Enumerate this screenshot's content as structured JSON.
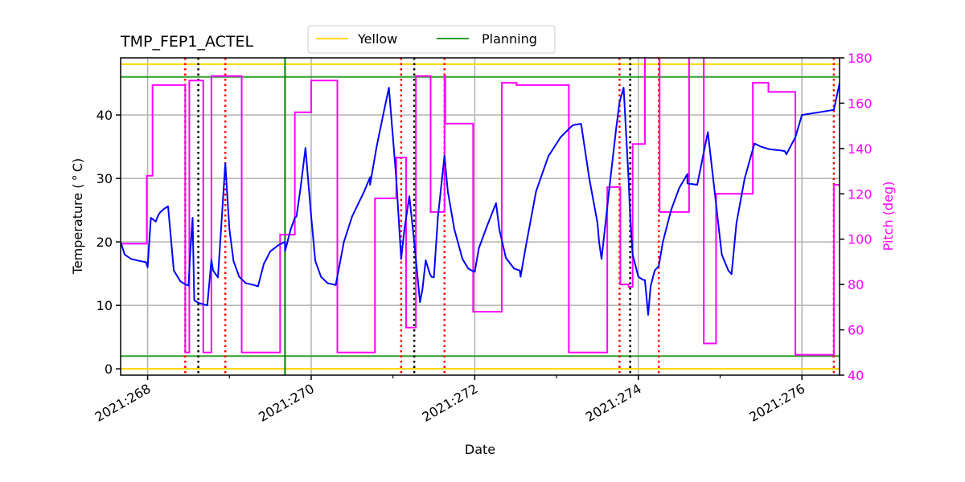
{
  "chart_data": {
    "type": "line",
    "title": "TMP_FEP1_ACTEL",
    "xlabel": "Date",
    "ylabel": "Temperature ($^\\circ$C)",
    "ylabel_display": "Temperature ( ° C)",
    "y2label": "Pitch (deg)",
    "xlim": [
      267.67,
      276.46
    ],
    "ylim": [
      -1,
      49
    ],
    "y2lim": [
      40,
      180
    ],
    "x_ticks": [
      268,
      270,
      272,
      274,
      276
    ],
    "x_tick_labels": [
      "2021:268",
      "2021:270",
      "2021:272",
      "2021:274",
      "2021:276"
    ],
    "x_minor_ticks": [
      269,
      271,
      273,
      275
    ],
    "y_ticks": [
      0,
      10,
      20,
      30,
      40
    ],
    "y2_ticks": [
      40,
      60,
      80,
      100,
      120,
      140,
      160,
      180
    ],
    "grid": true,
    "legend": {
      "placement": "top-center",
      "entries": [
        {
          "label": "Yellow",
          "color": "#ffd700"
        },
        {
          "label": "Planning",
          "color": "#2ca02c"
        }
      ]
    },
    "colors": {
      "temperature": "#0000ff",
      "pitch": "#ff00ff",
      "yellow": "#ffd700",
      "planning": "#2ca02c",
      "now_line": "#008000",
      "red_markers": "#ff0000",
      "black_markers": "#000000",
      "grid": "#b0b0b0",
      "y2_axis": "#ff00ff"
    },
    "limits": {
      "yellow_hi": 48,
      "yellow_lo": 0,
      "planning_hi": 46,
      "planning_lo": 2
    },
    "now_line_x": 269.68,
    "red_dotted_x": [
      268.46,
      268.95,
      271.1,
      271.63,
      273.77,
      274.25,
      276.39
    ],
    "black_dotted_x": [
      268.62,
      271.26,
      273.9
    ],
    "series": [
      {
        "name": "TMP_FEP1_ACTEL",
        "axis": "left",
        "x": [
          267.67,
          267.72,
          267.8,
          267.9,
          267.98,
          268.0,
          268.0,
          268.04,
          268.1,
          268.13,
          268.15,
          268.2,
          268.25,
          268.32,
          268.4,
          268.46,
          268.5,
          268.52,
          268.55,
          268.57,
          268.62,
          268.7,
          268.73,
          268.78,
          268.8,
          268.86,
          268.95,
          269.0,
          269.05,
          269.12,
          269.2,
          269.3,
          269.35,
          269.42,
          269.5,
          269.6,
          269.68,
          269.68,
          269.75,
          269.8,
          269.82,
          269.87,
          269.93,
          270.0,
          270.05,
          270.12,
          270.2,
          270.3,
          270.4,
          270.5,
          270.65,
          270.72,
          270.72,
          270.8,
          270.88,
          270.95,
          271.04,
          271.1,
          271.14,
          271.2,
          271.26,
          271.33,
          271.36,
          271.4,
          271.45,
          271.47,
          271.5,
          271.55,
          271.63,
          271.67,
          271.75,
          271.85,
          271.92,
          271.96,
          272.0,
          272.05,
          272.15,
          272.26,
          272.3,
          272.38,
          272.48,
          272.55,
          272.56,
          272.62,
          272.75,
          272.9,
          273.05,
          273.15,
          273.2,
          273.3,
          273.4,
          273.5,
          273.52,
          273.55,
          273.65,
          273.73,
          273.77,
          273.82,
          273.88,
          273.9,
          273.93,
          274.0,
          274.06,
          274.08,
          274.12,
          274.15,
          274.2,
          274.25,
          274.3,
          274.4,
          274.5,
          274.6,
          274.6,
          274.72,
          274.72,
          274.85,
          274.95,
          275.02,
          275.1,
          275.14,
          275.14,
          275.2,
          275.3,
          275.42,
          275.5,
          275.6,
          275.75,
          275.79,
          275.81,
          275.92,
          276.0,
          276.2,
          276.39,
          276.46
        ],
        "y": [
          20.0,
          18.0,
          17.3,
          17.0,
          16.8,
          16.0,
          16.0,
          23.8,
          23.2,
          24.2,
          24.6,
          25.2,
          25.6,
          15.5,
          13.8,
          13.3,
          13.1,
          18.0,
          23.8,
          10.8,
          10.4,
          10.1,
          10.0,
          17.2,
          15.5,
          14.4,
          32.4,
          22.0,
          17.0,
          14.5,
          13.5,
          13.2,
          13.0,
          16.5,
          18.5,
          19.5,
          20.0,
          18.5,
          22.0,
          23.8,
          24.0,
          28.5,
          34.8,
          24.0,
          17.0,
          14.5,
          13.5,
          13.2,
          20.0,
          24.0,
          28.0,
          30.2,
          29.0,
          35.0,
          40.0,
          44.3,
          30.0,
          17.3,
          22.0,
          27.2,
          20.0,
          10.5,
          12.5,
          17.1,
          15.0,
          14.5,
          14.4,
          24.0,
          33.6,
          28.0,
          22.0,
          17.3,
          15.8,
          15.5,
          15.3,
          19.0,
          22.5,
          26.1,
          22.0,
          17.5,
          15.8,
          15.5,
          14.5,
          19.0,
          28.0,
          33.5,
          36.5,
          37.8,
          38.4,
          38.6,
          30.0,
          23.0,
          20.0,
          17.3,
          29.0,
          38.0,
          42.0,
          44.3,
          30.0,
          24.0,
          18.0,
          14.5,
          14.0,
          14.0,
          8.5,
          13.0,
          15.5,
          16.2,
          20.0,
          25.0,
          28.5,
          30.7,
          29.2,
          29.0,
          29.0,
          37.3,
          26.0,
          18.0,
          15.5,
          14.9,
          15.0,
          23.0,
          30.0,
          35.5,
          35.0,
          34.6,
          34.4,
          34.3,
          33.8,
          36.5,
          40.0,
          40.4,
          40.8,
          45.0
        ]
      },
      {
        "name": "Pitch",
        "axis": "right",
        "step": true,
        "x": [
          267.67,
          267.96,
          267.99,
          268.02,
          268.06,
          268.13,
          268.23,
          268.46,
          268.47,
          268.51,
          268.56,
          268.68,
          268.7,
          268.78,
          268.91,
          269.15,
          269.17,
          269.2,
          269.62,
          269.68,
          269.8,
          269.97,
          270.0,
          270.01,
          270.32,
          270.66,
          270.67,
          270.78,
          270.93,
          271.04,
          271.11,
          271.16,
          271.21,
          271.28,
          271.36,
          271.46,
          271.63,
          271.64,
          271.81,
          271.98,
          272.0,
          272.11,
          272.26,
          272.33,
          272.51,
          272.58,
          273.15,
          273.46,
          273.48,
          273.62,
          273.74,
          273.78,
          273.82,
          273.88,
          273.93,
          274.05,
          274.08,
          274.16,
          274.25,
          274.26,
          274.6,
          274.62,
          274.76,
          274.8,
          274.93,
          274.95,
          275.14,
          275.4,
          275.59,
          275.77,
          275.92,
          276.03,
          276.39,
          276.42
        ],
        "y": [
          98,
          98,
          128,
          128,
          168,
          168,
          168,
          50,
          50,
          170,
          170,
          50,
          50,
          172,
          172,
          50,
          50,
          50,
          102,
          102,
          156,
          156,
          170,
          170,
          50,
          50,
          50,
          118,
          118,
          136,
          136,
          61,
          61,
          172,
          172,
          112,
          172,
          151,
          151,
          68,
          68,
          68,
          68,
          169,
          168,
          168,
          50,
          50,
          50,
          123,
          123,
          80,
          80,
          79,
          142,
          142,
          190,
          190,
          190,
          112,
          112,
          190,
          190,
          54,
          54,
          120,
          120,
          169,
          165,
          165,
          49,
          49,
          124,
          124,
          110,
          110,
          171,
          171,
          120,
          120,
          166
        ]
      }
    ]
  }
}
